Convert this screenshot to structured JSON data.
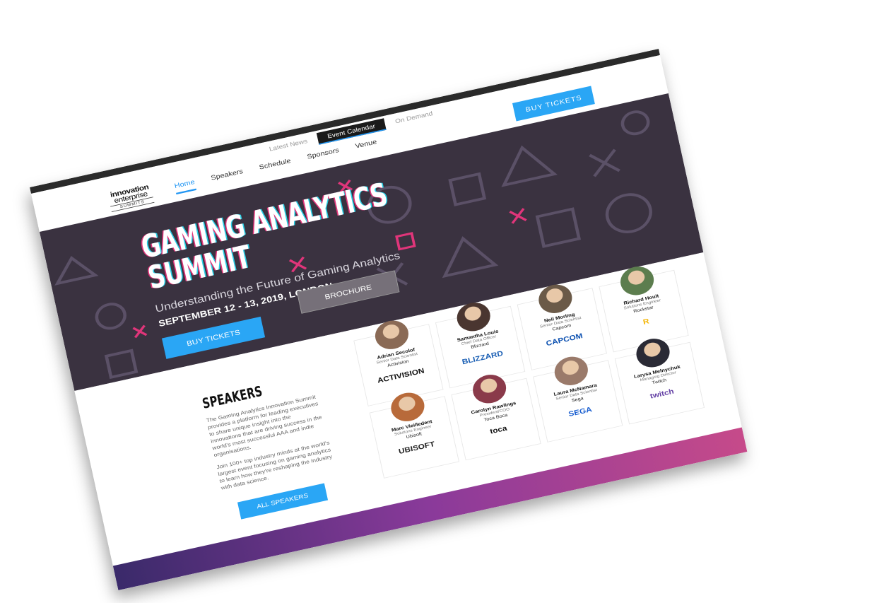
{
  "util_nav": {
    "items": [
      "Latest News",
      "Event Calendar",
      "On Demand"
    ]
  },
  "header": {
    "logo_line1": "innovation",
    "logo_line2": "enterprise",
    "logo_line3": "SUMMITS",
    "nav": [
      "Home",
      "Speakers",
      "Schedule",
      "Sponsors",
      "Venue"
    ],
    "buy_tickets": "BUY TICKETS"
  },
  "hero": {
    "title_line1": "GAMING ANALYTICS",
    "title_line2": "SUMMIT",
    "subtitle": "Understanding the Future of Gaming Analytics",
    "date": "SEPTEMBER 12 - 13, 2019, LONDON",
    "buy_tickets": "BUY TICKETS",
    "brochure": "BROCHURE"
  },
  "speakers_section": {
    "title": "SPEAKERS",
    "desc1": "The Gaming Analytics Innovation Summit provides a platform for leading executives to share unique insight into the innovations that are driving success in the world's most successful AAA and indie organisations.",
    "desc2": "Join 100+ top industry minds at the world's largest event focusing on gaming analytics to learn how they're reshaping the industry with data science.",
    "all_speakers": "ALL SPEAKERS"
  },
  "speakers": [
    {
      "name": "Adrian Secolof",
      "title": "Senior Data Scientist",
      "company": "Activision",
      "logo": "ACTIVISION",
      "logo_color": "#111111",
      "avatar": "#8a6a55"
    },
    {
      "name": "Samantha Louis",
      "title": "Chief Data Officer",
      "company": "Blizzard",
      "logo": "BLIZZARD",
      "logo_color": "#1a5fb4",
      "avatar": "#4a3630"
    },
    {
      "name": "Neil Morling",
      "title": "Senior Data Scientist",
      "company": "Capcom",
      "logo": "CAPCOM",
      "logo_color": "#0a4fb0",
      "avatar": "#6b5a48"
    },
    {
      "name": "Richard Hoult",
      "title": "Solutions Engineer",
      "company": "Rockstar",
      "logo": "R",
      "logo_color": "#f4b400",
      "avatar": "#5c7d4e"
    },
    {
      "name": "Marc Vieilledent",
      "title": "Solutions Engineer",
      "company": "Ubisoft",
      "logo": "UBISOFT",
      "logo_color": "#222222",
      "avatar": "#b86a3a"
    },
    {
      "name": "Carolyn Rawlings",
      "title": "President/COO",
      "company": "Toca Boca",
      "logo": "toca",
      "logo_color": "#111111",
      "avatar": "#8a3a4a"
    },
    {
      "name": "Laura McNamara",
      "title": "Senior Data Scientist",
      "company": "Sega",
      "logo": "SEGA",
      "logo_color": "#1a5fd0",
      "avatar": "#9a7a6a"
    },
    {
      "name": "Larysa Melnychuk",
      "title": "Managing Director",
      "company": "Twitch",
      "logo": "twitch",
      "logo_color": "#6441a5",
      "avatar": "#2a2a35"
    }
  ],
  "colors": {
    "accent": "#2aa6f5",
    "hero_bg": "#3a3240",
    "pink": "#e0357a"
  }
}
